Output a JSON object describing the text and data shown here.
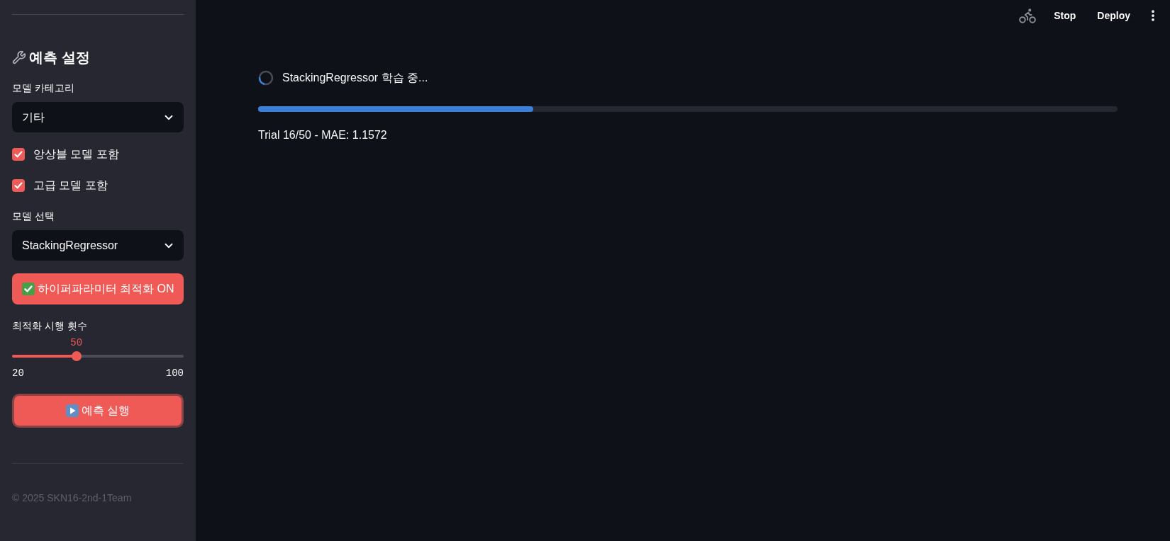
{
  "sidebar": {
    "heading": "예측 설정",
    "category": {
      "label": "모델 카테고리",
      "value": "기타"
    },
    "checkboxes": [
      {
        "label": "앙상블 모델 포함",
        "checked": true
      },
      {
        "label": "고급 모델 포함",
        "checked": true
      }
    ],
    "model": {
      "label": "모델 선택",
      "value": "StackingRegressor"
    },
    "toggle_button": {
      "label": "하이퍼파라미터 최적화 ON"
    },
    "slider": {
      "label": "최적화 시행 횟수",
      "value": "50",
      "level": 0.375,
      "min": "20",
      "max": "100"
    },
    "run_button": {
      "label": "예측 실행",
      "focused": true
    },
    "footer": "© 2025 SKN16-2nd-1Team"
  },
  "toolbar": {
    "buttons": [
      "Stop",
      "Deploy"
    ]
  },
  "main": {
    "status": "StackingRegressor 학습 중...",
    "progress": {
      "level": 0.32
    },
    "message": "Trial 16/50 - MAE: 1.1572"
  }
}
